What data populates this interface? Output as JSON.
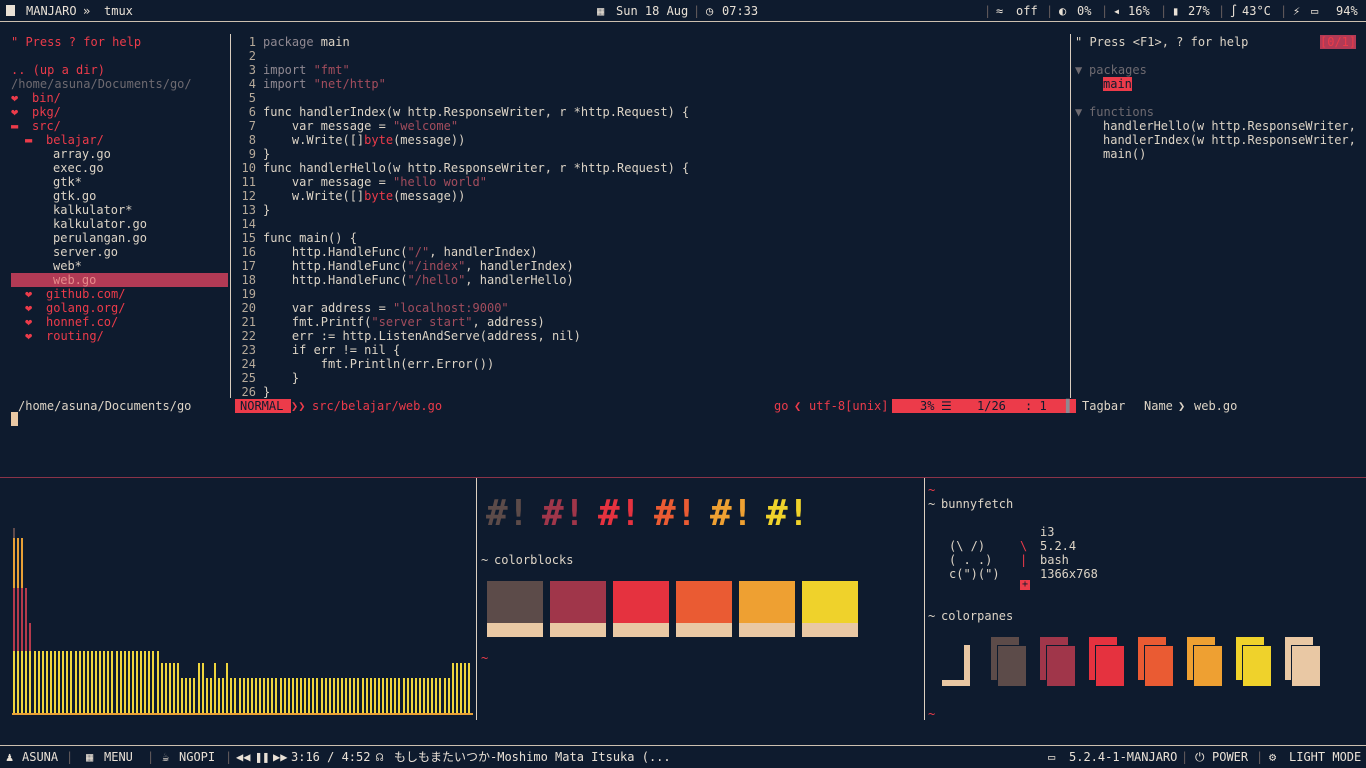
{
  "topbar": {
    "workspace": "MANJARO",
    "arrow": "»",
    "window_title": "tmux",
    "date": "Sun 18 Aug",
    "time": "07:33",
    "wifi": "off",
    "cpu": "0%",
    "volume": "16%",
    "memory": "27%",
    "temp": "43°C",
    "battery": "94%"
  },
  "nerdtree": {
    "help": "\" Press ? for help",
    "updir": ".. (up a dir)",
    "root": "/home/asuna/Documents/go/",
    "items": [
      {
        "label": "bin/",
        "indent": 0,
        "kind": "dir"
      },
      {
        "label": "pkg/",
        "indent": 0,
        "kind": "dir"
      },
      {
        "label": "src/",
        "indent": 0,
        "kind": "open"
      },
      {
        "label": "belajar/",
        "indent": 1,
        "kind": "open"
      },
      {
        "label": "array.go",
        "indent": 2,
        "kind": "file"
      },
      {
        "label": "exec.go",
        "indent": 2,
        "kind": "file"
      },
      {
        "label": "gtk*",
        "indent": 2,
        "kind": "file"
      },
      {
        "label": "gtk.go",
        "indent": 2,
        "kind": "file"
      },
      {
        "label": "kalkulator*",
        "indent": 2,
        "kind": "file"
      },
      {
        "label": "kalkulator.go",
        "indent": 2,
        "kind": "file"
      },
      {
        "label": "perulangan.go",
        "indent": 2,
        "kind": "file"
      },
      {
        "label": "server.go",
        "indent": 2,
        "kind": "file"
      },
      {
        "label": "web*",
        "indent": 2,
        "kind": "file"
      },
      {
        "label": "web.go",
        "indent": 2,
        "kind": "selected"
      },
      {
        "label": "github.com/",
        "indent": 1,
        "kind": "dir"
      },
      {
        "label": "golang.org/",
        "indent": 1,
        "kind": "dir"
      },
      {
        "label": "honnef.co/",
        "indent": 1,
        "kind": "dir"
      },
      {
        "label": "routing/",
        "indent": 1,
        "kind": "dir"
      }
    ],
    "status_path": "/home/asuna/Documents/go"
  },
  "editor": {
    "lines": [
      [
        [
          "package ",
          "dim"
        ],
        [
          "main",
          "kw"
        ]
      ],
      [],
      [
        [
          "import ",
          "dim"
        ],
        [
          "\"fmt\"",
          "str"
        ]
      ],
      [
        [
          "import ",
          "dim"
        ],
        [
          "\"net/http\"",
          "str"
        ]
      ],
      [],
      [
        [
          "func handlerIndex(w http.ResponseWriter, r *http.Request) {",
          "kw"
        ]
      ],
      [
        [
          "    var message = ",
          "kw"
        ],
        [
          "\"welcome\"",
          "str"
        ]
      ],
      [
        [
          "    w.Write([]",
          "kw"
        ],
        [
          "byte",
          "pk"
        ],
        [
          "(message))",
          "kw"
        ]
      ],
      [
        [
          "}",
          "kw"
        ]
      ],
      [
        [
          "func handlerHello(w http.ResponseWriter, r *http.Request) {",
          "kw"
        ]
      ],
      [
        [
          "    var message = ",
          "kw"
        ],
        [
          "\"hello world\"",
          "str"
        ]
      ],
      [
        [
          "    w.Write([]",
          "kw"
        ],
        [
          "byte",
          "pk"
        ],
        [
          "(message))",
          "kw"
        ]
      ],
      [
        [
          "}",
          "kw"
        ]
      ],
      [],
      [
        [
          "func main() {",
          "kw"
        ]
      ],
      [
        [
          "    http.HandleFunc(",
          "kw"
        ],
        [
          "\"/\"",
          "str"
        ],
        [
          ", handlerIndex)",
          "kw"
        ]
      ],
      [
        [
          "    http.HandleFunc(",
          "kw"
        ],
        [
          "\"/index\"",
          "str"
        ],
        [
          ", handlerIndex)",
          "kw"
        ]
      ],
      [
        [
          "    http.HandleFunc(",
          "kw"
        ],
        [
          "\"/hello\"",
          "str"
        ],
        [
          ", handlerHello)",
          "kw"
        ]
      ],
      [],
      [
        [
          "    var address = ",
          "kw"
        ],
        [
          "\"localhost:9000\"",
          "str"
        ]
      ],
      [
        [
          "    fmt.Printf(",
          "kw"
        ],
        [
          "\"server start\"",
          "str"
        ],
        [
          ", address)",
          "kw"
        ]
      ],
      [
        [
          "    err := http.ListenAndServe(address, nil)",
          "kw"
        ]
      ],
      [
        [
          "    if err != nil {",
          "kw"
        ]
      ],
      [
        [
          "        fmt.Println(err.Error())",
          "kw"
        ]
      ],
      [
        [
          "    }",
          "kw"
        ]
      ],
      [
        [
          "}",
          "kw"
        ]
      ]
    ],
    "mode": "NORMAL",
    "file": "src/belajar/web.go",
    "filetype": "go",
    "encoding": "utf-8[unix]",
    "percent": "3%",
    "position": "1/26",
    "column": ":  1"
  },
  "tagbar": {
    "help": "\" Press <F1>, ? for help",
    "counter": "[0/1]",
    "packages_label": "packages",
    "package_main": "main",
    "functions_label": "functions",
    "functions": [
      "handlerHello(w http.ResponseWriter,",
      "handlerIndex(w http.ResponseWriter,",
      "main()"
    ],
    "status_name": "Tagbar",
    "status_field": "Name",
    "status_file": "web.go"
  },
  "colorblocks": {
    "tilde1": "~",
    "title": "colorblocks",
    "tilde2": "~",
    "glyph": "#!",
    "colors": [
      "#5c4b49",
      "#a0364a",
      "#e5323f",
      "#ea5b33",
      "#eea032",
      "#efd22b"
    ],
    "cream": "#e9c8a4"
  },
  "bunnyfetch": {
    "tilde1": "~",
    "title": "bunnyfetch",
    "art": [
      "(\\ /)",
      "( . .)",
      "c(\")(\")"
    ],
    "seps": [
      "",
      "\\",
      "|",
      ""
    ],
    "values": [
      "i3",
      "5.2.4",
      "bash",
      "1366x768"
    ],
    "plus": "+",
    "title2": "colorpanes",
    "tilde2": "~",
    "tilde3": "~",
    "pane_colors": [
      "#e9c8a4",
      "#5c4b49",
      "#a0364a",
      "#e5323f",
      "#ea5b33",
      "#eea032",
      "#efd22b",
      "#e9c8a4"
    ]
  },
  "visualizer": {
    "heights": [
      185,
      175,
      175,
      125,
      90,
      62,
      62,
      62,
      62,
      62,
      62,
      62,
      62,
      62,
      62,
      62,
      62,
      62,
      62,
      62,
      62,
      62,
      62,
      62,
      62,
      62,
      62,
      62,
      62,
      62,
      62,
      62,
      62,
      62,
      62,
      62,
      50,
      50,
      50,
      50,
      50,
      35,
      35,
      35,
      35,
      50,
      50,
      35,
      35,
      50,
      35,
      35,
      50,
      35,
      35,
      35,
      35,
      35,
      35,
      35,
      35,
      35,
      35,
      35,
      35,
      35,
      35,
      35,
      35,
      35,
      35,
      35,
      35,
      35,
      35,
      35,
      35,
      35,
      35,
      35,
      35,
      35,
      35,
      35,
      35,
      35,
      35,
      35,
      35,
      35,
      35,
      35,
      35,
      35,
      35,
      35,
      35,
      35,
      35,
      35,
      35,
      35,
      35,
      35,
      35,
      35,
      35,
      50,
      50,
      50,
      50,
      50
    ],
    "colors": [
      "#eed53d",
      "#e8a036",
      "#b53a4c",
      "#5f4a4c"
    ]
  },
  "bottombar": {
    "user": "ASUNA",
    "menu": "MENU",
    "ngopi": "NGOPI",
    "player_time": "3:16 / 4:52",
    "song": "もしもまたいつか-Moshimo Mata Itsuka (...",
    "kernel": "5.2.4-1-MANJARO",
    "power": "POWER",
    "mode": "LIGHT MODE"
  }
}
